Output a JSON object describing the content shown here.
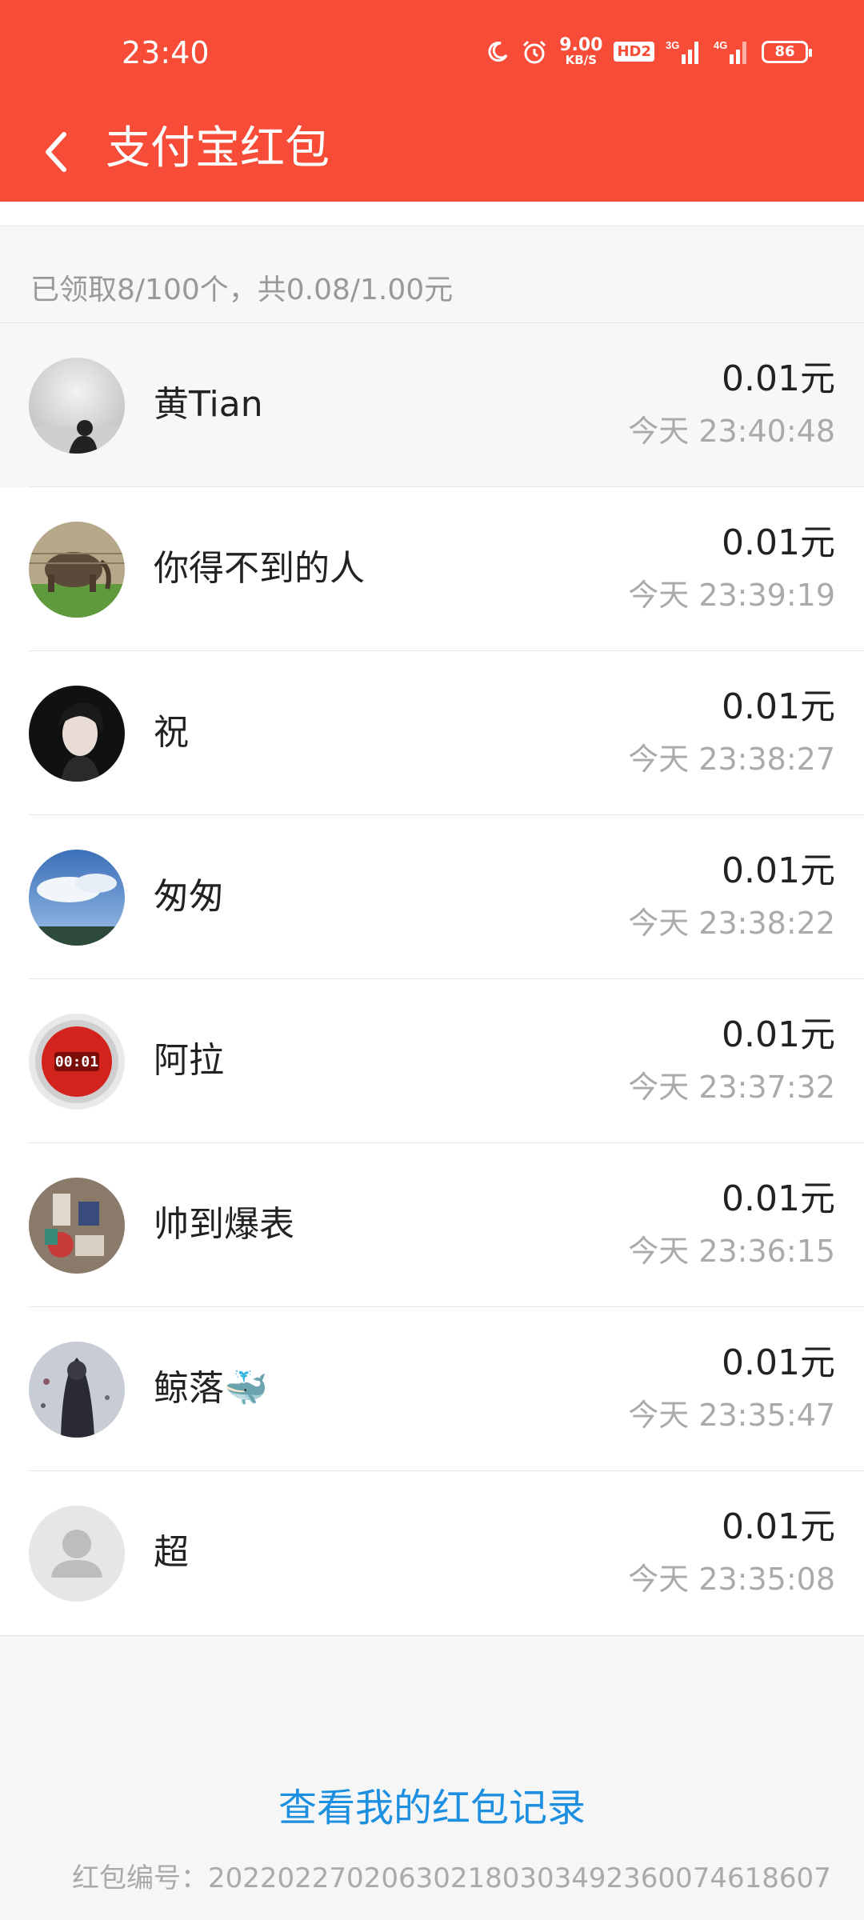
{
  "status_bar": {
    "time": "23:40",
    "net_speed_value": "9.00",
    "net_speed_unit": "KB/S",
    "hd_label": "HD2",
    "sim1_label": "3G",
    "sim2_label": "4G",
    "battery": "86",
    "icons": [
      "moon-icon",
      "alarm-icon",
      "signal-icon",
      "signal-icon"
    ]
  },
  "nav": {
    "title": "支付宝红包",
    "back_icon": "chevron-left-icon"
  },
  "summary": {
    "text": "已领取8/100个，共0.08/1.00元"
  },
  "records": [
    {
      "name": "黄Tian",
      "amount": "0.01元",
      "time": "今天 23:40:48",
      "avatar": "mist-silhouette"
    },
    {
      "name": "你得不到的人",
      "amount": "0.01元",
      "time": "今天 23:39:19",
      "avatar": "elephant-photo"
    },
    {
      "name": "祝",
      "amount": "0.01元",
      "time": "今天 23:38:27",
      "avatar": "anime-portrait"
    },
    {
      "name": "匆匆",
      "amount": "0.01元",
      "time": "今天 23:38:22",
      "avatar": "blue-sky"
    },
    {
      "name": "阿拉",
      "amount": "0.01元",
      "time": "今天 23:37:32",
      "avatar": "red-timer-button"
    },
    {
      "name": "帅到爆表",
      "amount": "0.01元",
      "time": "今天 23:36:15",
      "avatar": "cluttered-photo"
    },
    {
      "name": "鲸落🐳",
      "amount": "0.01元",
      "time": "今天 23:35:47",
      "avatar": "dark-figure"
    },
    {
      "name": "超",
      "amount": "0.01元",
      "time": "今天 23:35:08",
      "avatar": "default-person"
    }
  ],
  "footer": {
    "record_link": "查看我的红包记录",
    "packet_id": "红包编号：20220227020630218030349236007461860​7"
  },
  "colors": {
    "header_bg": "#f64c38",
    "link": "#1c8fe0"
  }
}
